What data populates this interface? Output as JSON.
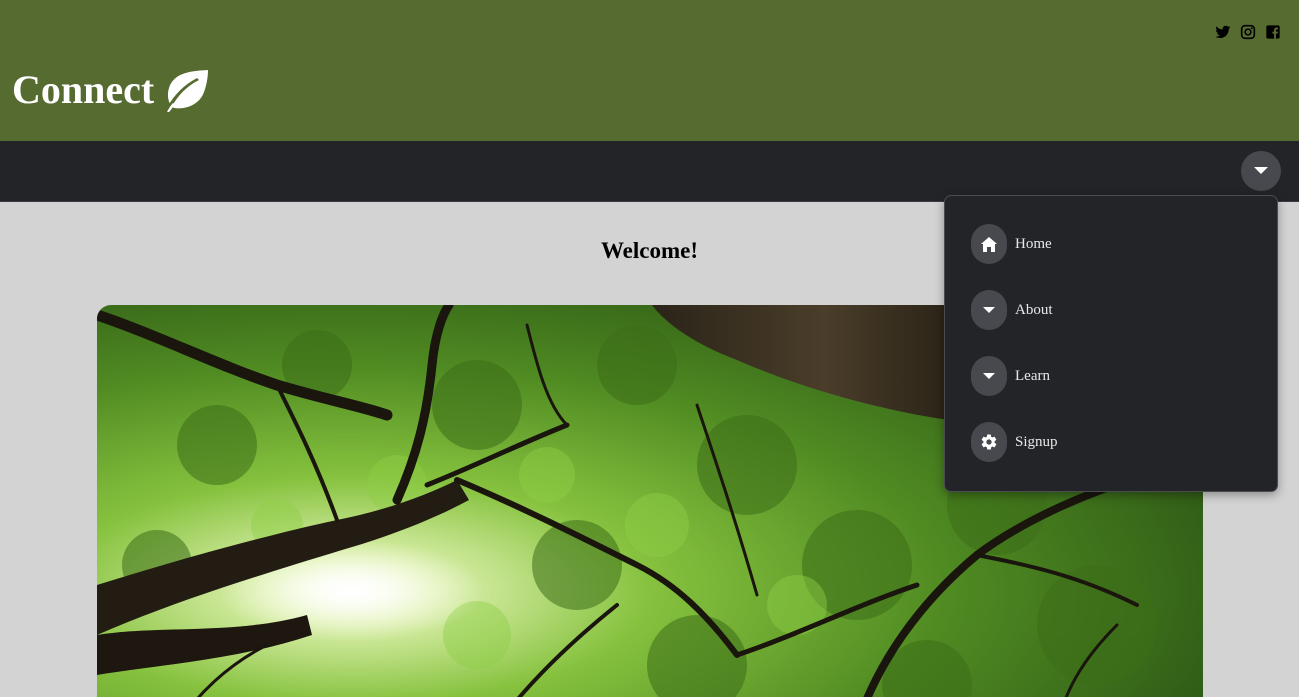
{
  "header": {
    "brand_text": "Connect",
    "brand_icon": "leaf-icon",
    "background_color": "#566b30",
    "socials": [
      {
        "name": "twitter-icon"
      },
      {
        "name": "instagram-icon"
      },
      {
        "name": "facebook-icon"
      }
    ]
  },
  "navbar": {
    "background_color": "#232428",
    "toggle_icon": "caret-down-icon"
  },
  "main": {
    "heading": "Welcome!",
    "hero_image": "forest-canopy-image"
  },
  "dropdown": {
    "items": [
      {
        "label": "Home",
        "icon": "home-icon"
      },
      {
        "label": "About",
        "icon": "caret-down-icon"
      },
      {
        "label": "Learn",
        "icon": "caret-down-icon"
      },
      {
        "label": "Signup",
        "icon": "gear-icon"
      }
    ]
  }
}
